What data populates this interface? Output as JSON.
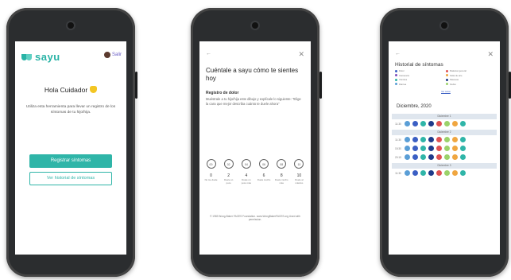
{
  "phone1": {
    "logo": "sayu",
    "user_label": "Salir",
    "greeting": "Hola Cuidador",
    "description": "Utiliza esta herramienta para llevar un registro de los síntomas de tu hijo/hija.",
    "primary_button": "Registrar síntomas",
    "secondary_button": "Ver historial de síntomas"
  },
  "phone2": {
    "back": "←",
    "close": "✕",
    "title": "Cuéntale a sayu cómo te sientes hoy",
    "section_title": "Registro de dolor",
    "section_desc": "Muéstrale a tu hijo/hija este dibujo y explícale lo siguiente: \"Elige la cara que mejor describa cuánto te duele ahora\"",
    "faces": [
      {
        "code": "00",
        "num": "0",
        "label": "No me duele"
      },
      {
        "code": "02",
        "num": "2",
        "label": "Duele un poco"
      },
      {
        "code": "04",
        "num": "4",
        "label": "Duele un poco más"
      },
      {
        "code": "06",
        "num": "6",
        "label": "Duele mucho"
      },
      {
        "code": "08",
        "num": "8",
        "label": "Duele mucho más"
      },
      {
        "code": "10",
        "num": "10",
        "label": "Duele al máximo"
      }
    ],
    "footer": "© 1983 Wong-Baker FACES Foundation. www.WongBakerFACES.org Used with permission."
  },
  "phone3": {
    "back": "←",
    "close": "✕",
    "title": "Historial de síntomas",
    "legend": [
      {
        "label": "Dolor",
        "color": "#3b5fc4"
      },
      {
        "label": "Malestar general",
        "color": "#e05252"
      },
      {
        "label": "Cansancio",
        "color": "#7c4dbd"
      },
      {
        "label": "Falta de aire",
        "color": "#f0a640"
      },
      {
        "label": "Vómitos",
        "color": "#2fb5a8"
      },
      {
        "label": "Náuseas",
        "color": "#1f3a8a"
      },
      {
        "label": "Diarrea",
        "color": "#5a9ed6"
      },
      {
        "label": "Fiebre",
        "color": "#9bd26a"
      }
    ],
    "legend_link": "Ver todos",
    "month": "Diciembre, 2020",
    "days": [
      {
        "label": "Diciembre 1",
        "times": [
          "11:30"
        ]
      },
      {
        "label": "Diciembre 2",
        "times": [
          "11:30",
          "15:30",
          "20:15"
        ]
      },
      {
        "label": "Diciembre 3",
        "times": [
          "11:30"
        ]
      }
    ],
    "dot_colors": [
      "#5a9ed6",
      "#3b5fc4",
      "#2fb5a8",
      "#1f3a8a",
      "#e05252",
      "#9bd26a",
      "#f0a640",
      "#2fb5a8"
    ]
  }
}
